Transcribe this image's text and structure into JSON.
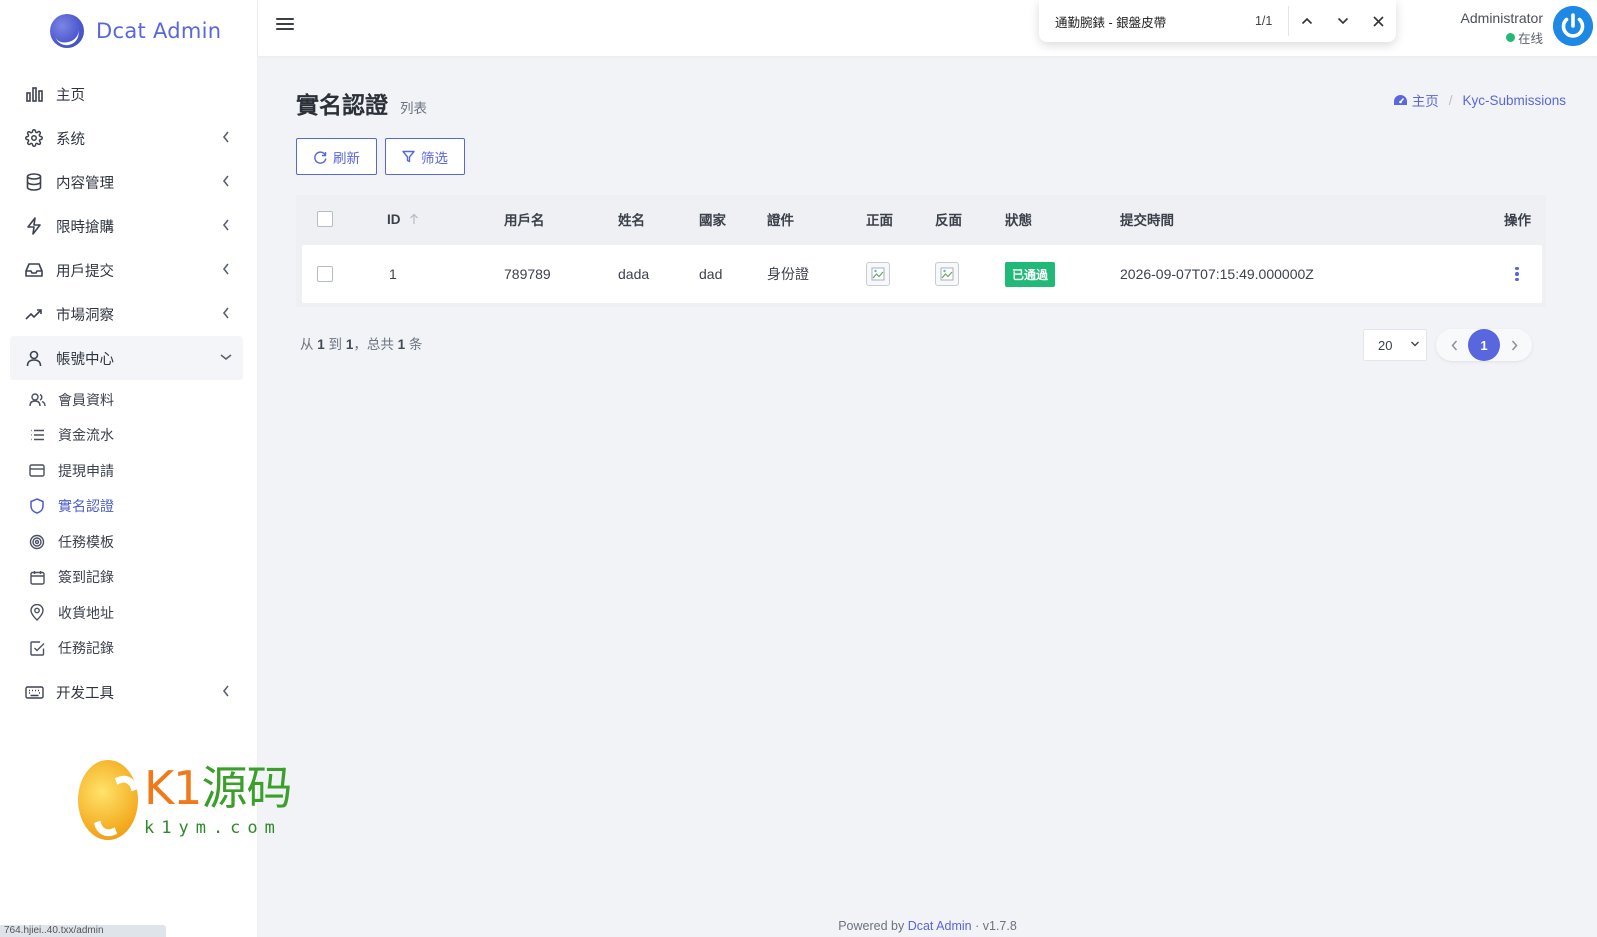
{
  "brand": {
    "name": "Dcat Admin"
  },
  "sidebar": {
    "items": [
      {
        "label": "主页",
        "icon": "bar-chart-icon"
      },
      {
        "label": "系统",
        "icon": "gear-icon"
      },
      {
        "label": "内容管理",
        "icon": "database-icon"
      },
      {
        "label": "限時搶購",
        "icon": "lightning-icon"
      },
      {
        "label": "用戶提交",
        "icon": "inbox-icon"
      },
      {
        "label": "市場洞察",
        "icon": "trending-up-icon"
      },
      {
        "label": "帳號中心",
        "icon": "user-icon"
      },
      {
        "label": "开发工具",
        "icon": "keyboard-icon"
      }
    ],
    "subitems": [
      {
        "label": "會員資料",
        "icon": "users-icon"
      },
      {
        "label": "資金流水",
        "icon": "list-icon"
      },
      {
        "label": "提現申請",
        "icon": "credit-card-icon"
      },
      {
        "label": "實名認證",
        "icon": "shield-icon"
      },
      {
        "label": "任務模板",
        "icon": "target-icon"
      },
      {
        "label": "簽到記錄",
        "icon": "calendar-icon"
      },
      {
        "label": "收貨地址",
        "icon": "map-pin-icon"
      },
      {
        "label": "任務記錄",
        "icon": "check-square-icon"
      }
    ]
  },
  "watermark": {
    "brand": "K1",
    "brand_cn": "源码",
    "domain": "k1ym.com"
  },
  "statusbar": {
    "url": "764.hjiei..40.txx/admin"
  },
  "findbar": {
    "query": "通勤腕錶 - 銀盤皮帶",
    "count": "1/1"
  },
  "user": {
    "name": "Administrator",
    "status": "在线"
  },
  "page": {
    "title": "實名認證",
    "subtitle": "列表"
  },
  "breadcrumb": {
    "home": "主页",
    "current": "Kyc-Submissions"
  },
  "toolbar": {
    "refresh": "刷新",
    "filter": "筛选"
  },
  "table": {
    "headers": {
      "id": "ID",
      "username": "用戶名",
      "name": "姓名",
      "country": "國家",
      "document": "證件",
      "front": "正面",
      "back": "反面",
      "status": "狀態",
      "submitted_at": "提交時間",
      "actions": "操作"
    },
    "rows": [
      {
        "id": "1",
        "username": "789789",
        "name": "dada",
        "country": "dad",
        "document": "身份證",
        "status": "已通過",
        "submitted_at": "2026-09-07T07:15:49.000000Z"
      }
    ]
  },
  "summary": {
    "prefix": "从",
    "from": "1",
    "to_label": "到",
    "to": "1",
    "total_label": "，总共",
    "total": "1",
    "suffix": "条"
  },
  "pagination": {
    "per_page": "20",
    "current": "1"
  },
  "footer": {
    "prefix": "Powered by",
    "link": "Dcat Admin",
    "sep": "·",
    "version": "v1.7.8"
  },
  "colors": {
    "accent": "#5867dd",
    "success": "#21b978",
    "background": "#f1f3f6"
  }
}
